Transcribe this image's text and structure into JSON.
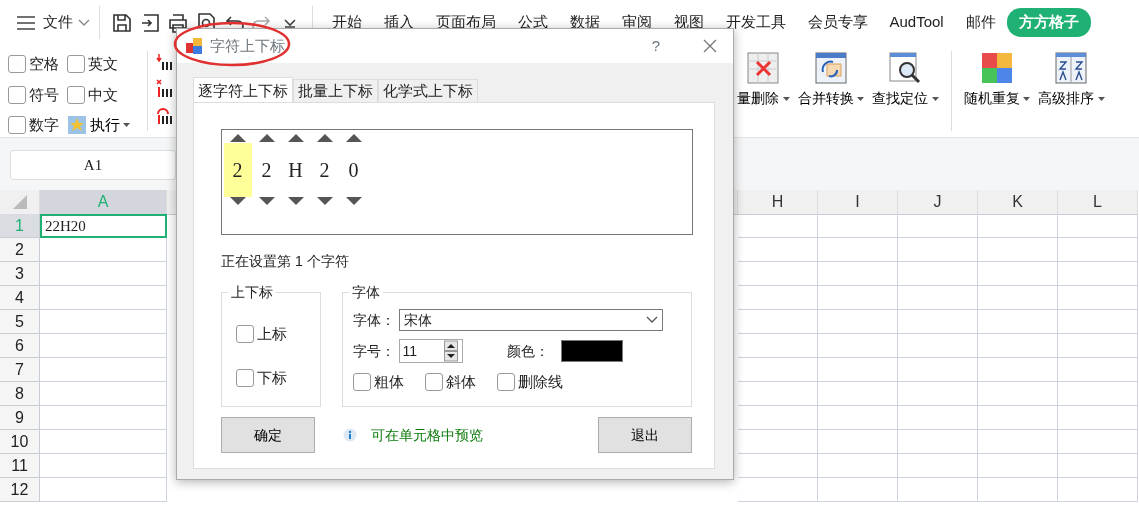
{
  "menu": {
    "file_label": "文件",
    "tabs": [
      {
        "label": "开始",
        "selected": false
      },
      {
        "label": "插入",
        "selected": false
      },
      {
        "label": "页面布局",
        "selected": false
      },
      {
        "label": "公式",
        "selected": false
      },
      {
        "label": "数据",
        "selected": false
      },
      {
        "label": "审阅",
        "selected": false
      },
      {
        "label": "视图",
        "selected": false
      },
      {
        "label": "开发工具",
        "selected": false
      },
      {
        "label": "会员专享",
        "selected": false
      },
      {
        "label": "AudTool",
        "selected": false
      },
      {
        "label": "邮件",
        "selected": false
      },
      {
        "label": "方方格子",
        "selected": true
      }
    ]
  },
  "ribbon": {
    "options": [
      {
        "label": "空格",
        "checked": false
      },
      {
        "label": "英文",
        "checked": false
      },
      {
        "label": "符号",
        "checked": false
      },
      {
        "label": "中文",
        "checked": false
      },
      {
        "label": "数字",
        "checked": false
      }
    ],
    "run_button": "执行",
    "tools": [
      {
        "label": "量删除",
        "kind": "delete"
      },
      {
        "label": "合并转换",
        "kind": "merge"
      },
      {
        "label": "查找定位",
        "kind": "find"
      },
      {
        "label": "随机重复",
        "kind": "random"
      },
      {
        "label": "高级排序",
        "kind": "sort"
      }
    ]
  },
  "name_box": "A1",
  "sheet": {
    "columns": [
      {
        "label": "A",
        "selected": true
      },
      {
        "label": "H",
        "selected": false
      },
      {
        "label": "I",
        "selected": false
      },
      {
        "label": "J",
        "selected": false
      },
      {
        "label": "K",
        "selected": false
      },
      {
        "label": "L",
        "selected": false
      }
    ],
    "rows": [
      {
        "label": "1",
        "selected": true
      },
      {
        "label": "2",
        "selected": false
      },
      {
        "label": "3",
        "selected": false
      },
      {
        "label": "4",
        "selected": false
      },
      {
        "label": "5",
        "selected": false
      },
      {
        "label": "6",
        "selected": false
      },
      {
        "label": "7",
        "selected": false
      },
      {
        "label": "8",
        "selected": false
      },
      {
        "label": "9",
        "selected": false
      },
      {
        "label": "10",
        "selected": false
      },
      {
        "label": "11",
        "selected": false
      },
      {
        "label": "12",
        "selected": false
      }
    ],
    "active_cell": "22H20"
  },
  "dialog": {
    "title": "字符上下标",
    "help": "?",
    "highlighted_title": true,
    "tabs": [
      {
        "label": "逐字符上下标",
        "selected": true
      },
      {
        "label": "批量上下标",
        "selected": false
      },
      {
        "label": "化学式上下标",
        "selected": false
      }
    ],
    "chars": [
      {
        "char": "2",
        "selected": true
      },
      {
        "char": "2",
        "selected": false
      },
      {
        "char": "H",
        "selected": false
      },
      {
        "char": "2",
        "selected": false
      },
      {
        "char": "0",
        "selected": false
      }
    ],
    "status": "正在设置第 1 个字符",
    "script_group": {
      "title": "上下标",
      "options": [
        {
          "label": "上标",
          "checked": false
        },
        {
          "label": "下标",
          "checked": false
        }
      ]
    },
    "font_group": {
      "title": "字体",
      "font_label": "字体：",
      "font_value": "宋体",
      "size_label": "字号：",
      "size_value": "11",
      "color_label": "颜色：",
      "color": "#000000",
      "styles": [
        {
          "label": "粗体",
          "checked": false
        },
        {
          "label": "斜体",
          "checked": false
        },
        {
          "label": "删除线",
          "checked": false
        }
      ]
    },
    "ok_button": "确定",
    "hint": "可在单元格中预览",
    "exit_button": "退出"
  }
}
